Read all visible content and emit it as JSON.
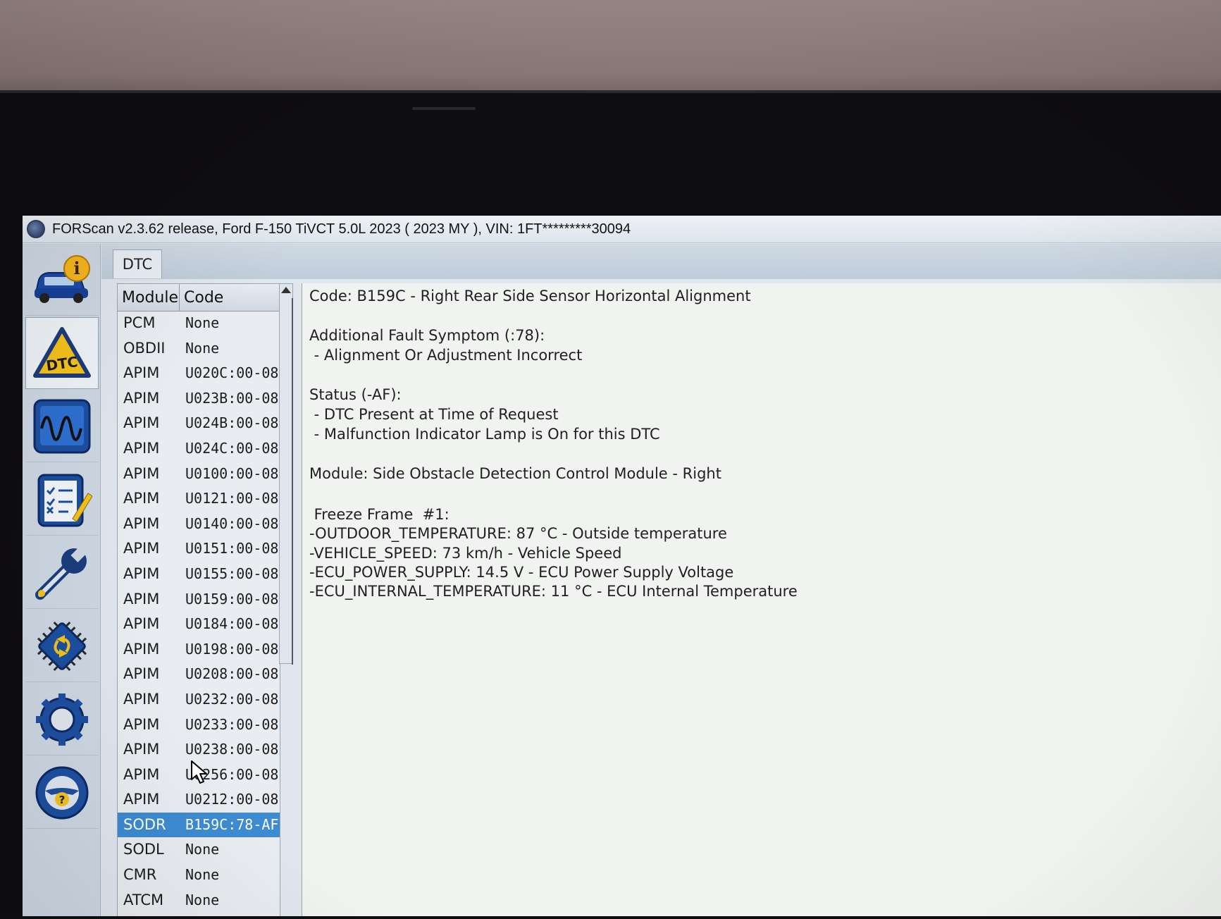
{
  "window": {
    "title": "FORScan v2.3.62 release, Ford F-150 TiVCT 5.0L 2023 ( 2023 MY ), VIN: 1FT*********30094"
  },
  "sidebar": {
    "items": [
      {
        "icon": "vehicle-info-icon"
      },
      {
        "icon": "dtc-icon",
        "label": "DTC",
        "active": true
      },
      {
        "icon": "oscilloscope-icon"
      },
      {
        "icon": "checklist-icon"
      },
      {
        "icon": "wrench-icon"
      },
      {
        "icon": "chip-icon"
      },
      {
        "icon": "gear-icon"
      },
      {
        "icon": "help-icon"
      }
    ]
  },
  "tabs": [
    {
      "label": "DTC"
    }
  ],
  "dtc_list": {
    "headers": {
      "module": "Module",
      "code": "Code"
    },
    "rows": [
      {
        "module": "PCM",
        "code": "None"
      },
      {
        "module": "OBDII",
        "code": "None"
      },
      {
        "module": "APIM",
        "code": "U020C:00-08"
      },
      {
        "module": "APIM",
        "code": "U023B:00-08"
      },
      {
        "module": "APIM",
        "code": "U024B:00-08"
      },
      {
        "module": "APIM",
        "code": "U024C:00-08"
      },
      {
        "module": "APIM",
        "code": "U0100:00-08"
      },
      {
        "module": "APIM",
        "code": "U0121:00-08"
      },
      {
        "module": "APIM",
        "code": "U0140:00-08"
      },
      {
        "module": "APIM",
        "code": "U0151:00-08"
      },
      {
        "module": "APIM",
        "code": "U0155:00-08"
      },
      {
        "module": "APIM",
        "code": "U0159:00-08"
      },
      {
        "module": "APIM",
        "code": "U0184:00-08"
      },
      {
        "module": "APIM",
        "code": "U0198:00-08"
      },
      {
        "module": "APIM",
        "code": "U0208:00-08"
      },
      {
        "module": "APIM",
        "code": "U0232:00-08"
      },
      {
        "module": "APIM",
        "code": "U0233:00-08"
      },
      {
        "module": "APIM",
        "code": "U0238:00-08"
      },
      {
        "module": "APIM",
        "code": "U0256:00-08"
      },
      {
        "module": "APIM",
        "code": "U0212:00-08"
      },
      {
        "module": "SODR",
        "code": "B159C:78-AF",
        "selected": true
      },
      {
        "module": "SODL",
        "code": "None"
      },
      {
        "module": "CMR",
        "code": "None"
      },
      {
        "module": "ATCM",
        "code": "None"
      }
    ]
  },
  "detail": {
    "code_line": "Code: B159C - Right Rear Side Sensor Horizontal Alignment",
    "symptom_heading": "Additional Fault Symptom (:78):",
    "symptom_item": " - Alignment Or Adjustment Incorrect",
    "status_heading": "Status (-AF):",
    "status_items": [
      " - DTC Present at Time of Request",
      " - Malfunction Indicator Lamp is On for this DTC"
    ],
    "module_line": "Module: Side Obstacle Detection Control Module - Right",
    "freeze_frame_heading": " Freeze Frame  #1:",
    "freeze_frame_items": [
      "-OUTDOOR_TEMPERATURE: 87 °C - Outside temperature",
      "-VEHICLE_SPEED: 73 km/h - Vehicle Speed",
      "-ECU_POWER_SUPPLY: 14.5 V - ECU Power Supply Voltage",
      "-ECU_INTERNAL_TEMPERATURE: 11 °C - ECU Internal Temperature"
    ]
  }
}
